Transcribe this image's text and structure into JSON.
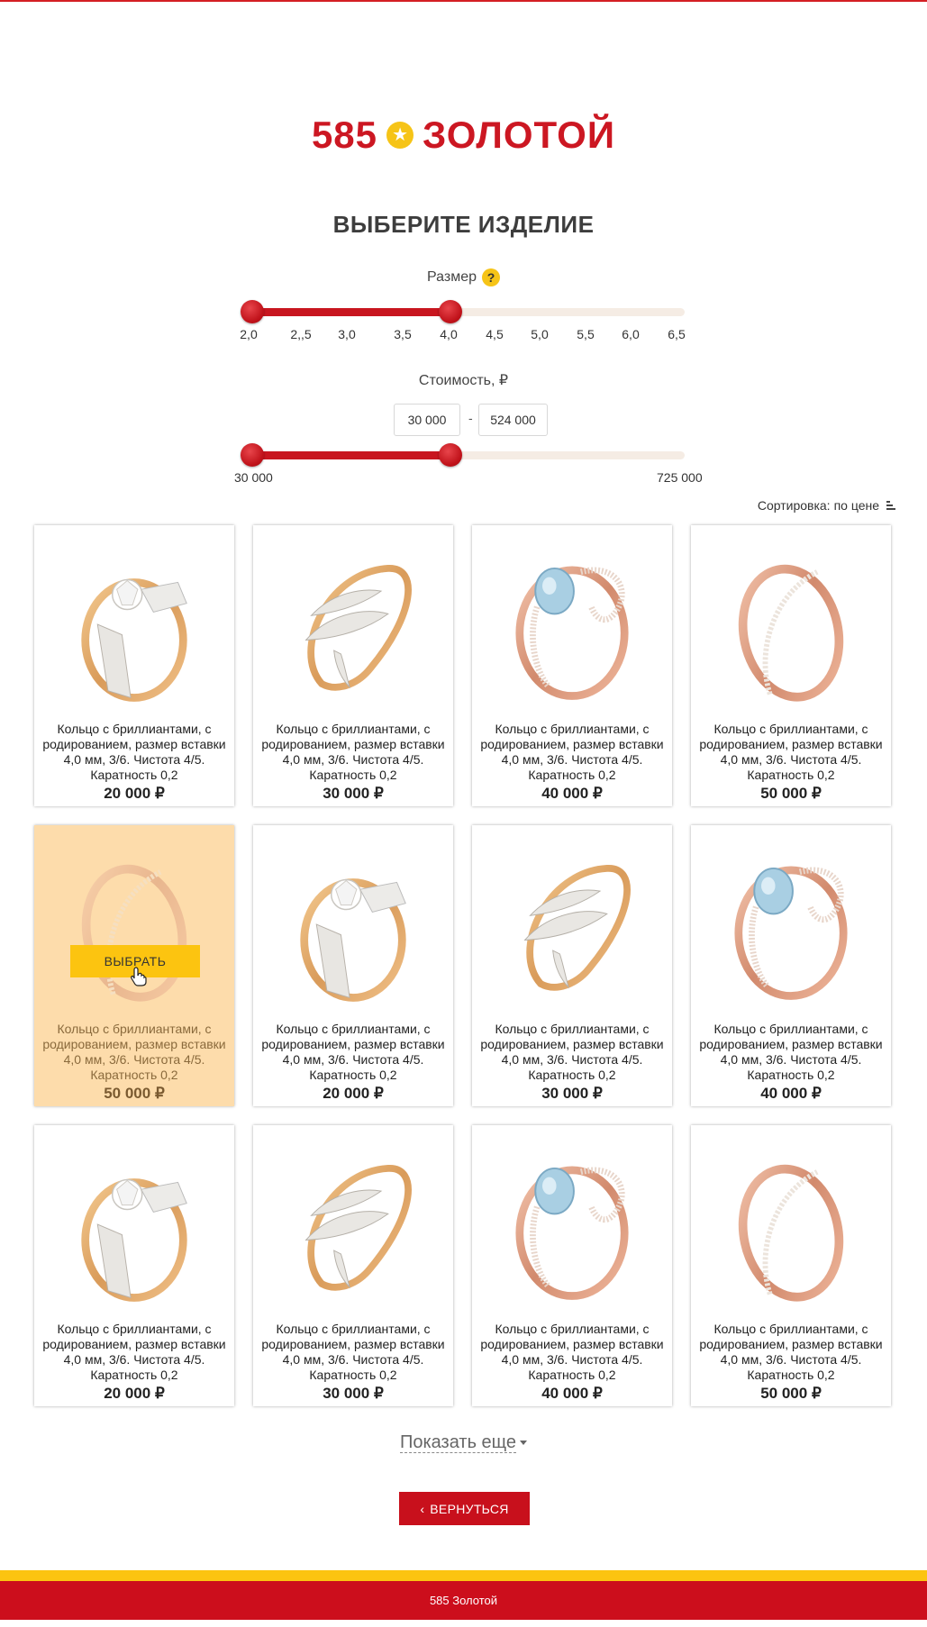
{
  "brand": {
    "number": "585",
    "word": "ЗОЛОТОЙ",
    "star_icon": "star-icon",
    "color": "#cc1722"
  },
  "page_title": "ВЫБЕРИТЕ ИЗДЕЛИЕ",
  "size_filter": {
    "label": "Размер",
    "help": "?",
    "ticks": [
      "2,0",
      "2,,5",
      "3,0",
      "3,5",
      "4,0",
      "4,5",
      "5,0",
      "5,5",
      "6,0",
      "6,5"
    ],
    "selected_min": "2,0",
    "selected_max": "4,0"
  },
  "price_filter": {
    "label": "Стоимость, ₽",
    "from": "30 000",
    "to": "524 000",
    "dash": "-",
    "min_label": "30 000",
    "max_label": "725 000"
  },
  "sort": {
    "label": "Сортировка:",
    "value": "по цене"
  },
  "products": [
    {
      "ring": "solitaire",
      "desc": "Кольцо с бриллиантами, с родированием, размер вставки 4,0 мм, 3/6. Чистота 4/5. Каратность 0,2",
      "price": "20 000 ₽"
    },
    {
      "ring": "leaf",
      "desc": "Кольцо с бриллиантами, с родированием, размер вставки 4,0 мм, 3/6. Чистота 4/5. Каратность 0,2",
      "price": "30 000 ₽"
    },
    {
      "ring": "topaz",
      "desc": "Кольцо с бриллиантами, с родированием, размер вставки 4,0 мм, 3/6. Чистота 4/5. Каратность 0,2",
      "price": "40 000 ₽"
    },
    {
      "ring": "band",
      "desc": "Кольцо с бриллиантами, с родированием, размер вставки 4,0 мм, 3/6. Чистота 4/5. Каратность 0,2",
      "price": "50 000 ₽"
    },
    {
      "ring": "band",
      "desc": "Кольцо с бриллиантами, с родированием, размер вставки 4,0 мм, 3/6. Чистота 4/5. Каратность 0,2",
      "price": "50 000 ₽"
    },
    {
      "ring": "solitaire",
      "desc": "Кольцо с бриллиантами, с родированием, размер вставки 4,0 мм, 3/6. Чистота 4/5. Каратность 0,2",
      "price": "20 000 ₽"
    },
    {
      "ring": "leaf",
      "desc": "Кольцо с бриллиантами, с родированием, размер вставки 4,0 мм, 3/6. Чистота 4/5. Каратность 0,2",
      "price": "30 000 ₽"
    },
    {
      "ring": "topaz",
      "desc": "Кольцо с бриллиантами, с родированием, размер вставки 4,0 мм, 3/6. Чистота 4/5. Каратность 0,2",
      "price": "40 000 ₽"
    },
    {
      "ring": "solitaire",
      "desc": "Кольцо с бриллиантами, с родированием, размер вставки 4,0 мм, 3/6. Чистота 4/5. Каратность 0,2",
      "price": "20 000 ₽"
    },
    {
      "ring": "leaf",
      "desc": "Кольцо с бриллиантами, с родированием, размер вставки 4,0 мм, 3/6. Чистота 4/5. Каратность 0,2",
      "price": "30 000 ₽"
    },
    {
      "ring": "topaz",
      "desc": "Кольцо с бриллиантами, с родированием, размер вставки 4,0 мм, 3/6. Чистота 4/5. Каратность 0,2",
      "price": "40 000 ₽"
    },
    {
      "ring": "band",
      "desc": "Кольцо с бриллиантами, с родированием, размер вставки 4,0 мм, 3/6. Чистота 4/5. Каратность 0,2",
      "price": "50 000 ₽"
    }
  ],
  "active_product": {
    "index": 4,
    "button": "ВЫБРАТЬ",
    "cursor_icon": "hand-cursor-icon"
  },
  "show_more": "Показать еще",
  "back_button": "ВЕРНУТЬСЯ",
  "footer": "585 Золотой",
  "colors": {
    "accent": "#cc0e1c",
    "yellow": "#fcc410",
    "hover": "#fddcab"
  }
}
